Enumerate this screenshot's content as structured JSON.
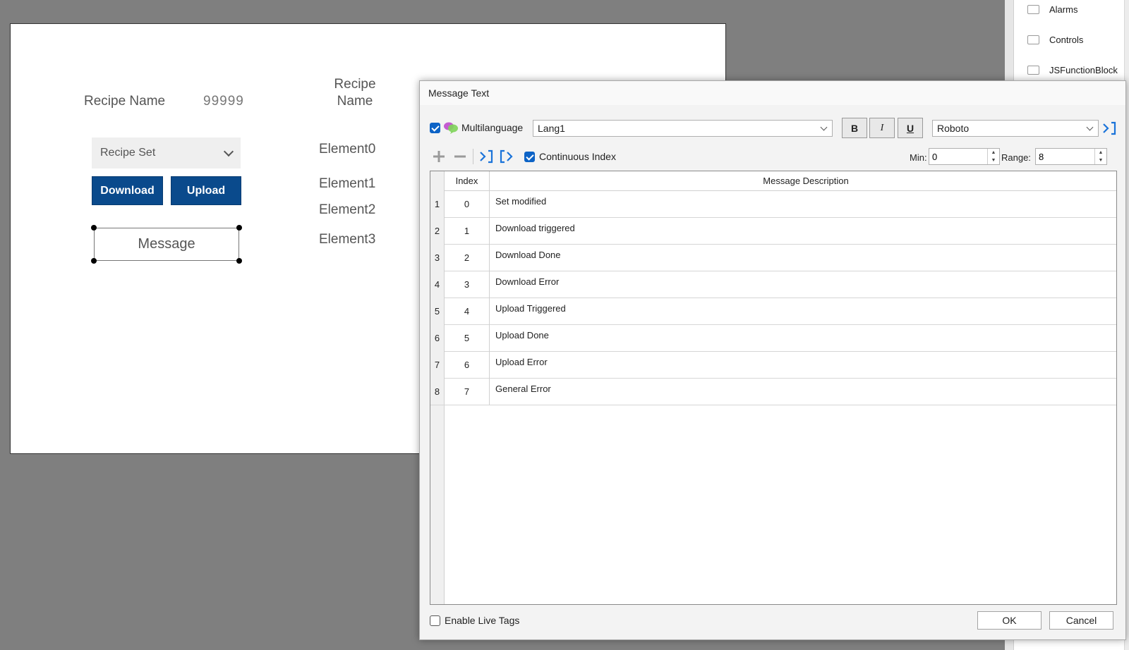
{
  "project_panel": {
    "items": [
      {
        "label": "Alarms",
        "icon": "folder-icon"
      },
      {
        "label": "Controls",
        "icon": "folder-icon"
      },
      {
        "label": "JSFunctionBlock",
        "icon": "folder-icon"
      }
    ]
  },
  "canvas": {
    "recipe_name_label": "Recipe Name",
    "recipe_value": "99999",
    "col_header": "Recipe\nName",
    "elements": [
      "Element0",
      "Element1",
      "Element2",
      "Element3"
    ],
    "recipe_select_value": "Recipe Set",
    "download_label": "Download",
    "upload_label": "Upload",
    "message_label": "Message"
  },
  "dialog": {
    "title": "Message Text",
    "multilanguage_label": "Multilanguage",
    "multilanguage_checked": true,
    "language_value": "Lang1",
    "bold_label": "B",
    "italic_label": "I",
    "underline_label": "U",
    "font_value": "Roboto",
    "continuous_index_label": "Continuous Index",
    "continuous_index_checked": true,
    "min_label": "Min:",
    "min_value": "0",
    "range_label": "Range:",
    "range_value": "8",
    "table": {
      "headers": {
        "index": "Index",
        "description": "Message Description"
      },
      "rows": [
        {
          "num": "1",
          "index": "0",
          "description": "Set modified"
        },
        {
          "num": "2",
          "index": "1",
          "description": "Download triggered"
        },
        {
          "num": "3",
          "index": "2",
          "description": "Download Done"
        },
        {
          "num": "4",
          "index": "3",
          "description": "Download Error"
        },
        {
          "num": "5",
          "index": "4",
          "description": "Upload Triggered"
        },
        {
          "num": "6",
          "index": "5",
          "description": "Upload Done"
        },
        {
          "num": "7",
          "index": "6",
          "description": "Upload Error"
        },
        {
          "num": "8",
          "index": "7",
          "description": "General Error"
        }
      ]
    },
    "enable_live_tags_label": "Enable Live Tags",
    "enable_live_tags_checked": false,
    "ok_label": "OK",
    "cancel_label": "Cancel"
  },
  "colors": {
    "accent_blue": "#0a4a8c",
    "checkbox_blue": "#0d63c6",
    "workspace_gray": "#7f7f7f"
  }
}
